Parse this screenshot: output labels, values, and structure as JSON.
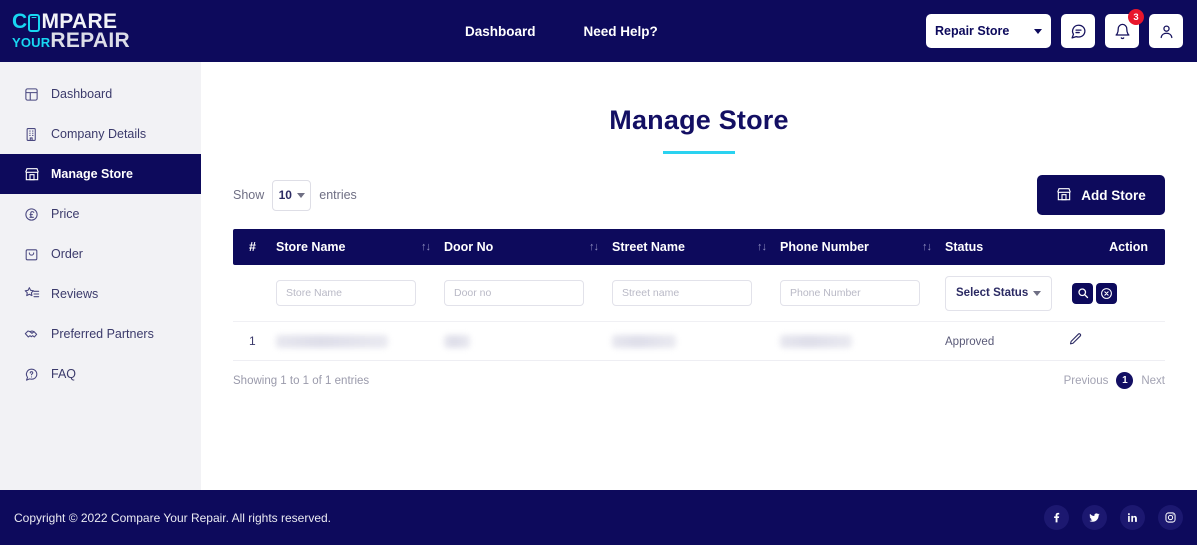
{
  "brand": {
    "logo_c": "C",
    "logo_rest": "MPARE",
    "logo_your": "YOUR",
    "logo_repair": "REPAIR"
  },
  "topnav": {
    "links": [
      {
        "label": "Dashboard"
      },
      {
        "label": "Need Help?"
      }
    ],
    "store_selector": {
      "label": "Repair Store"
    },
    "chat_icon": "chat-icon",
    "bell_icon": "bell-icon",
    "notification_count": "3",
    "user_icon": "user-icon"
  },
  "sidebar": {
    "items": [
      {
        "label": "Dashboard",
        "icon": "dashboard-icon",
        "active": false
      },
      {
        "label": "Company Details",
        "icon": "building-icon",
        "active": false
      },
      {
        "label": "Manage Store",
        "icon": "store-icon",
        "active": true
      },
      {
        "label": "Price",
        "icon": "pound-coin-icon",
        "active": false
      },
      {
        "label": "Order",
        "icon": "order-bag-icon",
        "active": false
      },
      {
        "label": "Reviews",
        "icon": "star-list-icon",
        "active": false
      },
      {
        "label": "Preferred Partners",
        "icon": "handshake-icon",
        "active": false
      },
      {
        "label": "FAQ",
        "icon": "question-chat-icon",
        "active": false
      }
    ]
  },
  "page": {
    "title": "Manage Store"
  },
  "toolbar": {
    "show_label": "Show",
    "entries_value": "10",
    "entries_label": "entries",
    "add_store_label": "Add Store"
  },
  "table": {
    "headers": [
      {
        "label": "#",
        "sortable": false
      },
      {
        "label": "Store Name",
        "sortable": true
      },
      {
        "label": "Door No",
        "sortable": true
      },
      {
        "label": "Street Name",
        "sortable": true
      },
      {
        "label": "Phone Number",
        "sortable": true
      },
      {
        "label": "Status",
        "sortable": false
      },
      {
        "label": "Action",
        "sortable": false
      }
    ],
    "sort_glyph": "↑↓",
    "filters": {
      "store_name_placeholder": "Store Name",
      "store_name_value": "",
      "door_no_placeholder": "Door no",
      "door_no_value": "",
      "street_name_placeholder": "Street name",
      "street_name_value": "",
      "phone_number_placeholder": "Phone Number",
      "phone_number_value": "",
      "status_select_label": "Select Status",
      "search_icon": "search-icon",
      "reset_icon": "reset-circle-x-icon"
    },
    "rows": [
      {
        "index": "1",
        "store_name": "",
        "door_no": "",
        "street_name": "",
        "phone_number": "",
        "status": "Approved",
        "action_icon": "edit-pencil-icon"
      }
    ]
  },
  "footer_table": {
    "showing_text": "Showing 1 to 1 of 1 entries",
    "previous_label": "Previous",
    "current_page": "1",
    "next_label": "Next"
  },
  "footer": {
    "copyright": "Copyright © 2022 Compare Your Repair. All rights reserved.",
    "socials": [
      {
        "name": "facebook-icon"
      },
      {
        "name": "twitter-icon"
      },
      {
        "name": "linkedin-icon"
      },
      {
        "name": "instagram-icon"
      }
    ]
  },
  "colors": {
    "navy": "#0d0a5c",
    "cyan": "#2ad2f0",
    "badge_red": "#e8162c",
    "sidebar_bg": "#f2f2f5"
  }
}
